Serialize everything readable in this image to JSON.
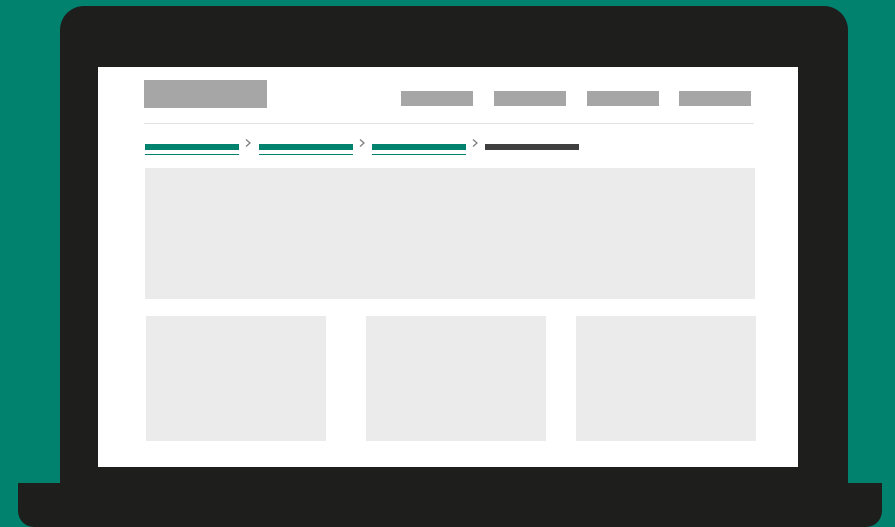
{
  "colors": {
    "background": "#00826f",
    "laptop": "#1e1e1c",
    "screen": "#ffffff",
    "placeholder_dark": "#a6a6a6",
    "placeholder_light": "#ebebeb",
    "breadcrumb_link": "#00826f",
    "breadcrumb_current": "#3f3f3f",
    "divider": "#e2e2e2"
  },
  "header": {
    "nav_items_count_visible": 4
  },
  "breadcrumb": {
    "separator_icon": "chevron-right-icon"
  }
}
